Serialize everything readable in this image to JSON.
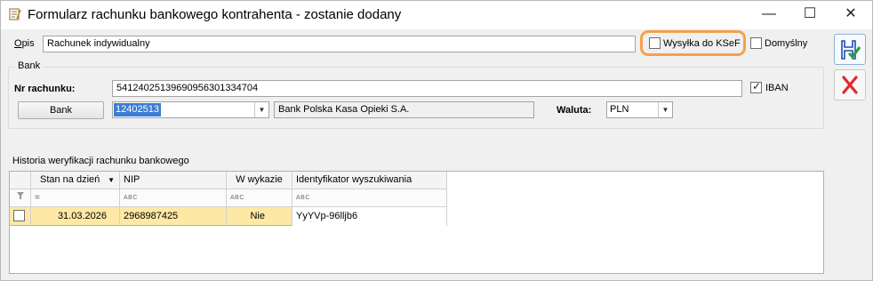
{
  "window": {
    "title": "Formularz rachunku bankowego kontrahenta - zostanie dodany",
    "controls": {
      "minimize": "—",
      "maximize": "☐",
      "close": "✕"
    }
  },
  "form": {
    "opis_label": "Opis",
    "opis_value": "Rachunek indywidualny",
    "wysylka_label": "Wysyłka do KSeF",
    "wysylka_checked": false,
    "domyslny_label": "Domyślny",
    "domyslny_checked": false
  },
  "bank_group": {
    "title": "Bank",
    "nr_label": "Nr rachunku:",
    "nr_value": "54124025139690956301334704",
    "iban_label": "IBAN",
    "iban_checked": true,
    "bank_button": "Bank",
    "bank_code": "12402513",
    "bank_name": "Bank Polska Kasa Opieki S.A.",
    "waluta_label": "Waluta:",
    "waluta_value": "PLN"
  },
  "history": {
    "title": "Historia weryfikacji rachunku bankowego",
    "columns": [
      "Stan na dzień",
      "NIP",
      "W wykazie",
      "Identyfikator wyszukiwania"
    ],
    "filter_symbols": [
      "=",
      "ABC",
      "ABC",
      "ABC"
    ],
    "rows": [
      {
        "date": "31.03.2026",
        "nip": "2968987425",
        "w_wykazie": "Nie",
        "identyfikator": "YyYVp-96lljb6"
      }
    ]
  },
  "colors": {
    "highlight": "#f5a14d",
    "row_selected": "#fde9a5",
    "selection": "#3a7dd4",
    "cancel_icon": "#e02a2a",
    "save_icon": "#1f4fae"
  },
  "icons": [
    "form-app-icon",
    "save-icon",
    "cancel-icon",
    "filter-icon",
    "sort-desc-icon",
    "dropdown-arrow-icon"
  ]
}
